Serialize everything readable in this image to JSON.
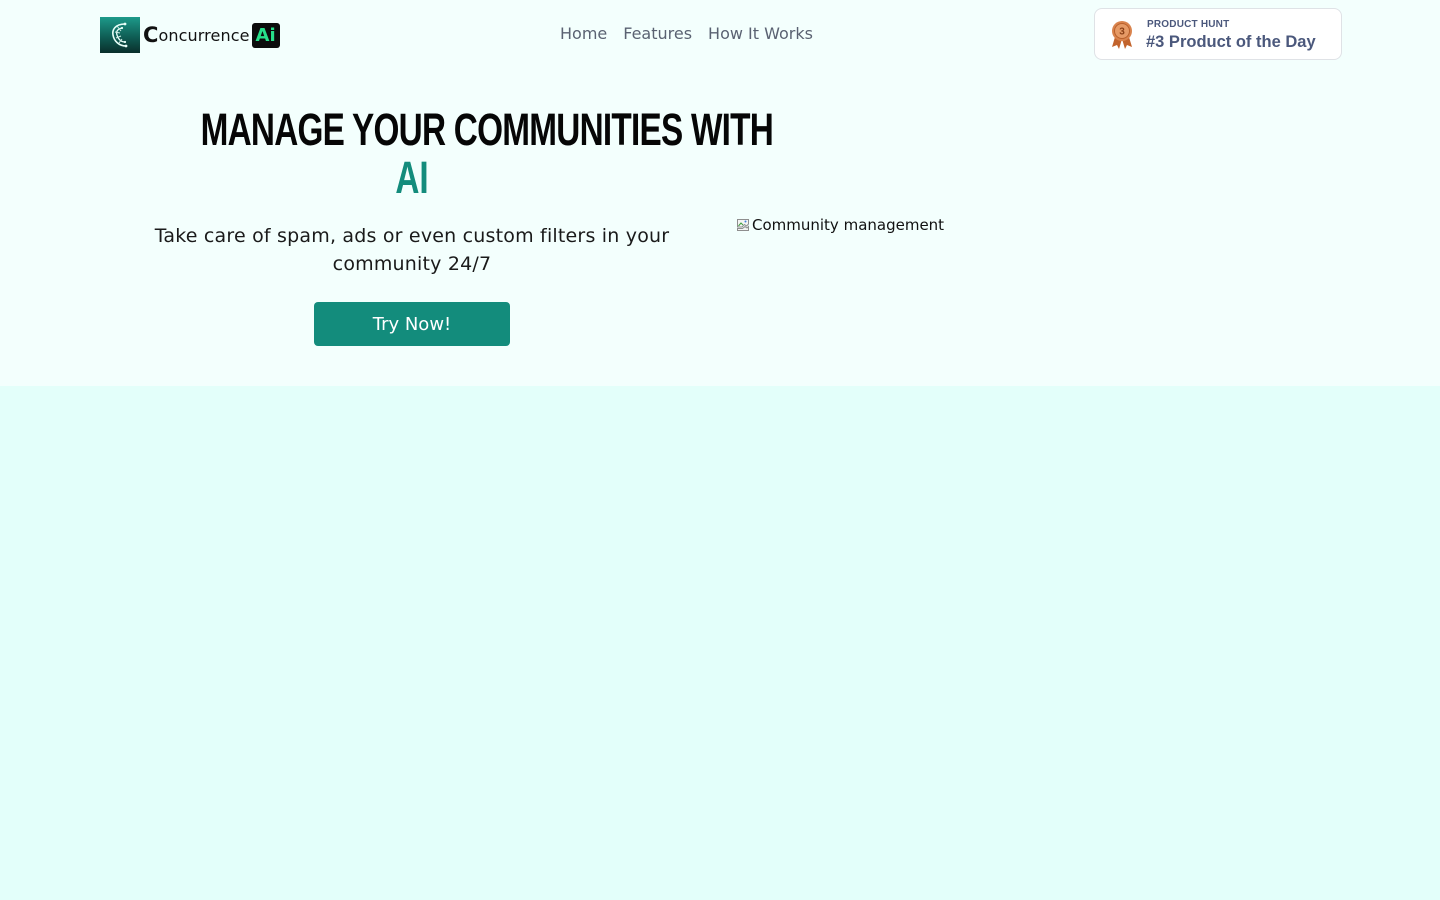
{
  "brand": {
    "name_initial": "C",
    "name_rest": "oncurrence",
    "badge": "Ai",
    "logo_icon": "concurrence-logo-icon"
  },
  "nav": {
    "items": [
      {
        "label": "Home"
      },
      {
        "label": "Features"
      },
      {
        "label": "How It Works"
      }
    ]
  },
  "product_hunt": {
    "kicker": "PRODUCT HUNT",
    "title": "#3 Product of the Day",
    "medal_number": "3",
    "medal_icon": "bronze-medal-icon"
  },
  "hero": {
    "title_line1": "Manage your communities with",
    "title_highlight": "AI",
    "subtitle": "Take care of spam, ads or even custom filters in your community 24/7",
    "cta_label": "Try Now!",
    "image_alt": "Community management",
    "image_icon": "broken-image-icon"
  },
  "colors": {
    "accent": "#138c7c",
    "page_bg": "#e3fffa",
    "hero_bg": "#f3fffd",
    "nav_text": "#5a6272",
    "badge_text": "#4b587c",
    "logo_badge_text": "#27e08a"
  }
}
